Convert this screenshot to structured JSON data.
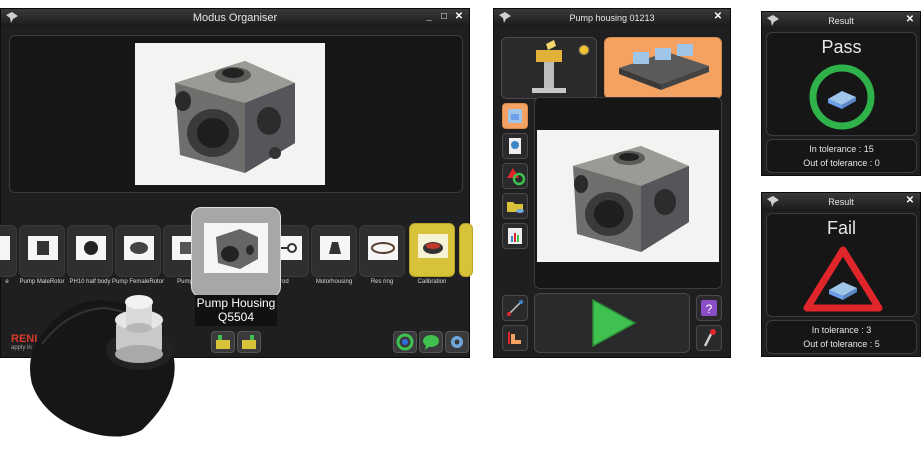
{
  "organiser": {
    "title": "Modus Organiser",
    "controls": [
      "_",
      "□",
      "✕"
    ],
    "carousel": [
      {
        "label": "e"
      },
      {
        "label": "Pump MaleRotor"
      },
      {
        "label": "PH10 half body"
      },
      {
        "label": "Pump FemaleRotor"
      },
      {
        "label": "Pump"
      },
      {
        "label": "enrod"
      },
      {
        "label": "Motorhousing"
      },
      {
        "label": "Res ring"
      },
      {
        "label": "Calibration"
      }
    ],
    "selected": {
      "line1": "Pump Housing",
      "line2": "Q5504"
    },
    "brand": "RENI",
    "brand_sub": "apply in"
  },
  "runner": {
    "title": "Pump housing 01213",
    "close": "✕"
  },
  "result_pass": {
    "title": "Result",
    "close": "✕",
    "verdict": "Pass",
    "in_tolerance": "In tolerance : 15",
    "out_tolerance": "Out of tolerance : 0",
    "accent": "#2fb24a"
  },
  "result_fail": {
    "title": "Result",
    "close": "✕",
    "verdict": "Fail",
    "in_tolerance": "In tolerance : 3",
    "out_tolerance": "Out of tolerance : 5",
    "accent": "#e0262a"
  },
  "colors": {
    "highlight": "#f4a261",
    "play": "#3ec14f",
    "folder": "#d8c23a",
    "purple": "#8a4fc7"
  }
}
